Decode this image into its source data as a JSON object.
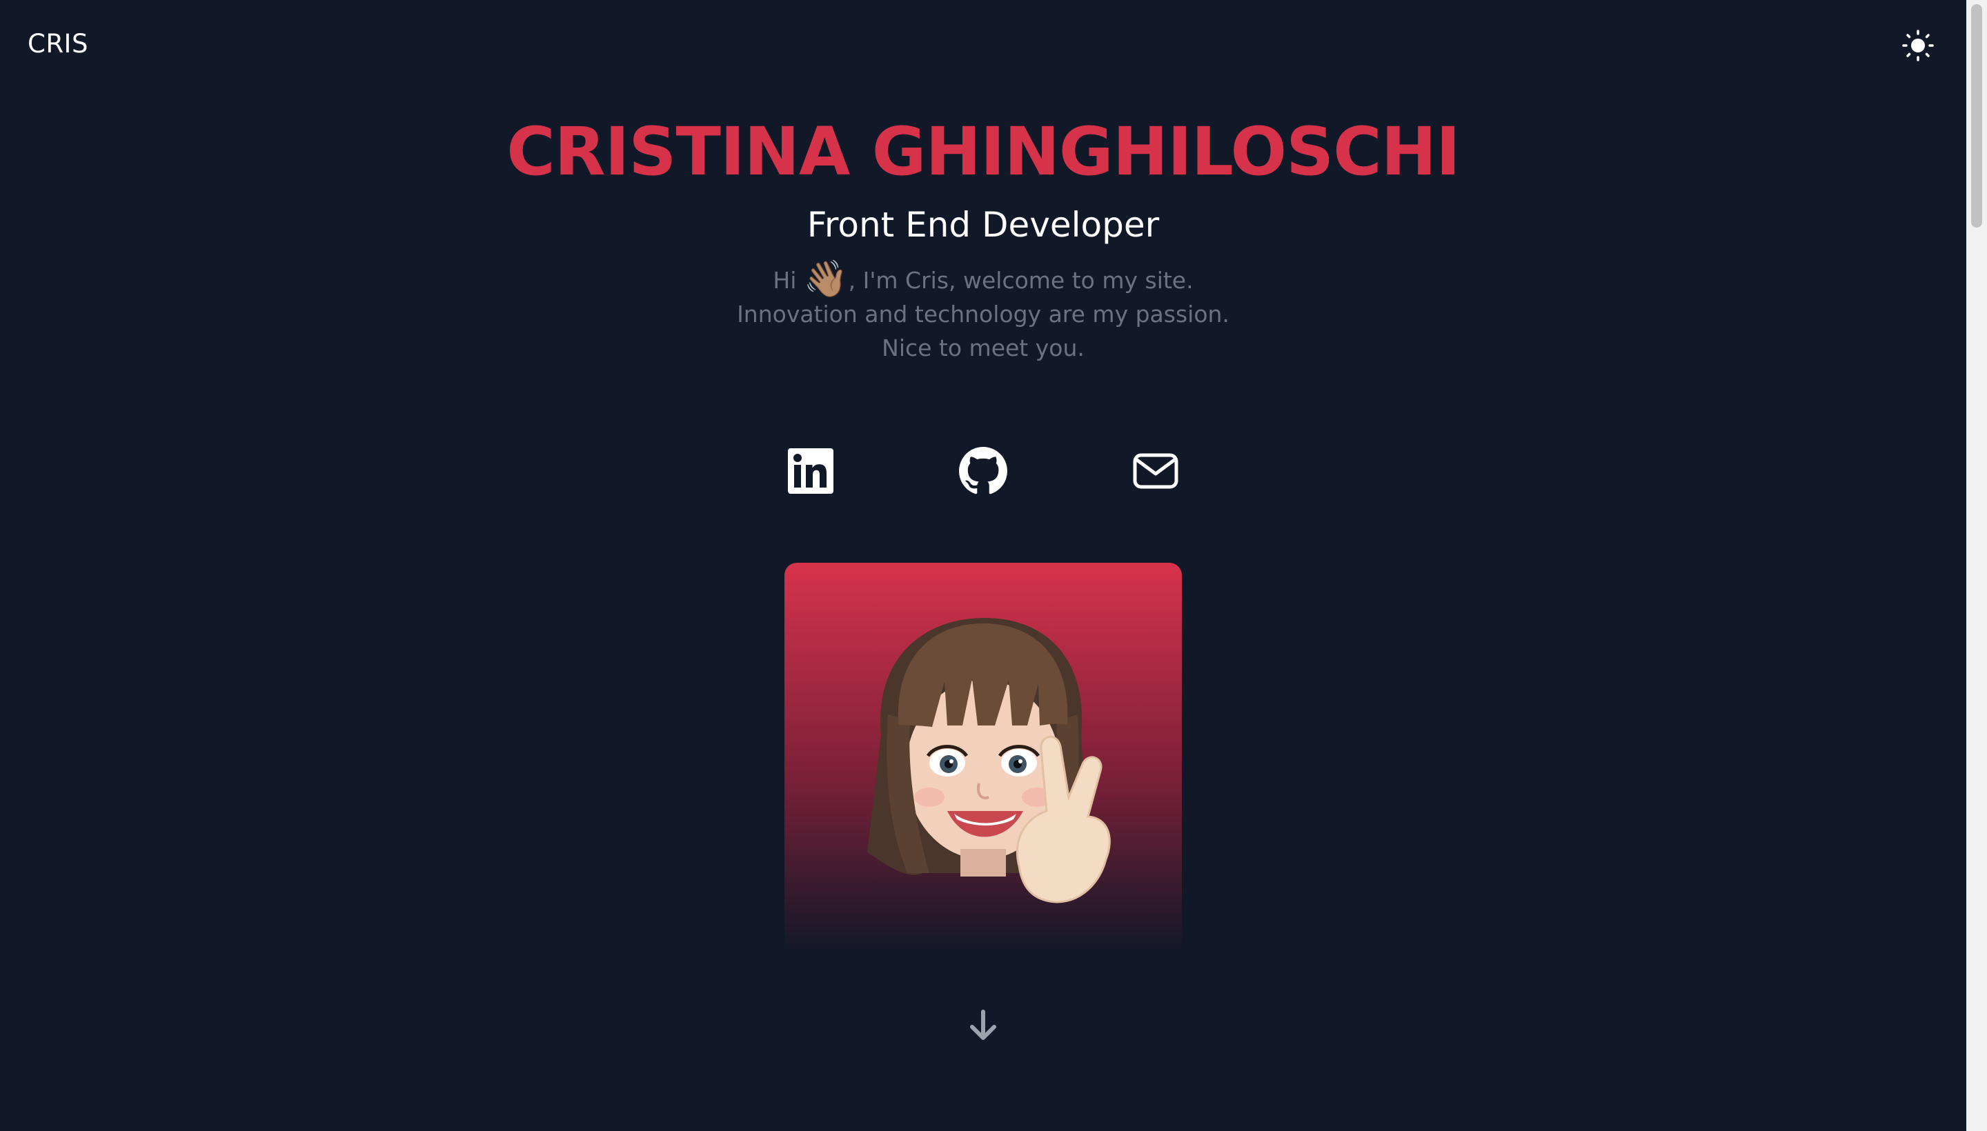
{
  "header": {
    "brand": "CRIS",
    "theme_icon": "sun-icon"
  },
  "hero": {
    "name": "CRISTINA GHINGHILOSCHI",
    "role": "Front End Developer",
    "intro_hi": "Hi",
    "wave_emoji": "👋🏽",
    "intro_line1_rest": ", I'm Cris, welcome to my site.",
    "intro_line2": "Innovation and technology are my passion.",
    "intro_line3": "Nice to meet you."
  },
  "socials": [
    {
      "icon": "linkedin-icon"
    },
    {
      "icon": "github-icon"
    },
    {
      "icon": "mail-icon"
    }
  ],
  "portrait": {
    "icon": "memoji-avatar"
  },
  "scroll": {
    "icon": "arrow-down-icon"
  },
  "colors": {
    "background": "#111827",
    "accent": "#d6334b",
    "text_primary": "#ffffff",
    "text_muted": "#6b7280"
  }
}
